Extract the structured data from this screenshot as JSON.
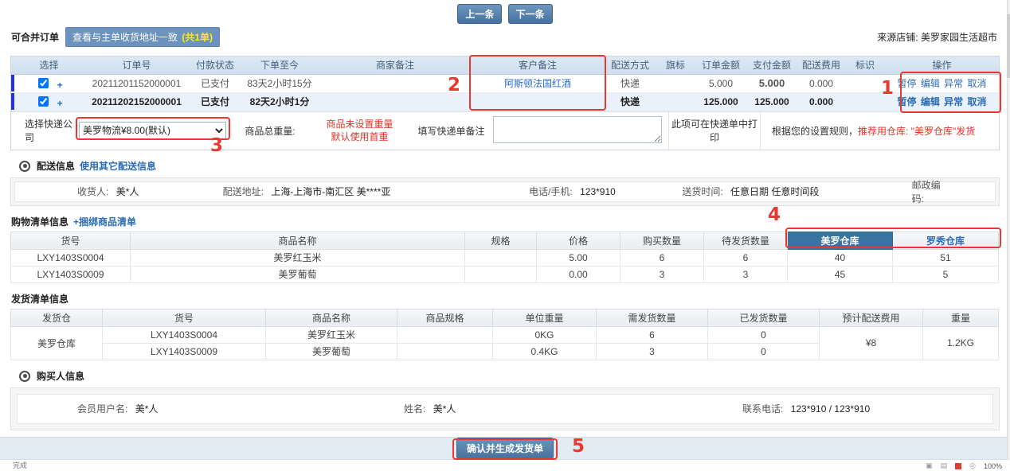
{
  "topbar": {
    "prev_button": "上一条",
    "next_button": "下一条"
  },
  "merge_bar": {
    "title": "可合并订单",
    "view_button": "查看与主单收货地址一致",
    "view_count": "(共1单)",
    "source_label": "来源店铺:",
    "source_value": "美罗家园生活超市"
  },
  "orders_table": {
    "headers": {
      "select": "选择",
      "order_no": "订单号",
      "pay_status": "付款状态",
      "since": "下单至今",
      "merchant_note": "商家备注",
      "customer_note": "客户备注",
      "delivery": "配送方式",
      "flag": "旗标",
      "order_amount": "订单金额",
      "pay_amount": "支付金额",
      "delivery_fee": "配送费用",
      "mark": "标识",
      "ops": "操作"
    },
    "op_labels": [
      "暂停",
      "编辑",
      "异常",
      "取消"
    ],
    "rows": [
      {
        "order_no": "20211201152000001",
        "pay_status": "已支付",
        "since": "83天2小时15分",
        "merchant_note": "",
        "customer_note": "阿斯顿法国红酒",
        "delivery": "快递",
        "flag": "",
        "order_amount": "5.000",
        "pay_amount": "5.000",
        "delivery_fee": "0.000",
        "mark": ""
      },
      {
        "order_no": "20211202152000001",
        "pay_status": "已支付",
        "since": "82天2小时1分",
        "merchant_note": "",
        "customer_note": "",
        "delivery": "快递",
        "flag": "",
        "order_amount": "125.000",
        "pay_amount": "125.000",
        "delivery_fee": "0.000",
        "mark": ""
      }
    ],
    "footer": {
      "express_label": "选择快递公司",
      "express_selected": "美罗物流¥8.00(默认)",
      "weight_label": "商品总重量:",
      "weight_warn_line1": "商品未设置重量",
      "weight_warn_line2": "默认使用首重",
      "note_label": "填写快递单备注",
      "print_hint": "此项可在快递单中打印",
      "rule_prefix": "根据您的设置规则，",
      "rule_red": "推荐用仓库: \"美罗仓库\"发货"
    }
  },
  "delivery_section": {
    "title": "配送信息",
    "other_link": "使用其它配送信息",
    "receiver_label": "收货人:",
    "receiver_value": "美*人",
    "address_label": "配送地址:",
    "address_value": "上海-上海市-南汇区 美****亚",
    "phone_label": "电话/手机:",
    "phone_value": "123*910",
    "time_label": "送货时间:",
    "time_value": "任意日期 任意时间段",
    "zip_label": "邮政编码:"
  },
  "purchase_section": {
    "title": "购物清单信息",
    "bundle_link": "+捆绑商品清单",
    "headers": {
      "sku": "货号",
      "name": "商品名称",
      "spec": "规格",
      "price": "价格",
      "qty": "购买数量",
      "pending": "待发货数量"
    },
    "warehouse_tabs": [
      {
        "label": "美罗仓库",
        "selected": true
      },
      {
        "label": "罗秀仓库",
        "selected": false
      }
    ],
    "rows": [
      {
        "sku": "LXY1403S0004",
        "name": "美罗红玉米",
        "spec": "",
        "price": "5.00",
        "qty": "6",
        "pending": "6",
        "wh1": "40",
        "wh2": "51"
      },
      {
        "sku": "LXY1403S0009",
        "name": "美罗葡萄",
        "spec": "",
        "price": "0.00",
        "qty": "3",
        "pending": "3",
        "wh1": "45",
        "wh2": "5"
      }
    ]
  },
  "shipment_section": {
    "title": "发货清单信息",
    "headers": {
      "warehouse": "发货仓",
      "sku": "货号",
      "name": "商品名称",
      "spec": "商品规格",
      "unit_weight": "单位重量",
      "need_qty": "需发货数量",
      "shipped_qty": "已发货数量",
      "est_fee": "预计配送费用",
      "weight": "重量"
    },
    "warehouse": "美罗仓库",
    "rows": [
      {
        "sku": "LXY1403S0004",
        "name": "美罗红玉米",
        "spec": "",
        "unit_weight": "0KG",
        "need_qty": "6",
        "shipped_qty": "0"
      },
      {
        "sku": "LXY1403S0009",
        "name": "美罗葡萄",
        "spec": "",
        "unit_weight": "0.4KG",
        "need_qty": "3",
        "shipped_qty": "0"
      }
    ],
    "est_fee": "¥8",
    "total_weight": "1.2KG"
  },
  "buyer_section": {
    "title": "购买人信息",
    "username_label": "会员用户名:",
    "username_value": "美*人",
    "name_label": "姓名:",
    "name_value": "美*人",
    "phone_label": "联系电话:",
    "phone_value": "123*910 / 123*910"
  },
  "footer_bar": {
    "confirm_button": "确认并生成发货单"
  },
  "statusbar": {
    "left_text": "完成",
    "zoom_text": "100%"
  },
  "annotations": {
    "n1": "1",
    "n2": "2",
    "n3": "3",
    "n4": "4",
    "n5": "5"
  },
  "colors": {
    "annotation_red": "#e8382f",
    "link_blue": "#2b6cb5",
    "price_red": "#ee0000",
    "selected_tab_bg": "#38759e",
    "primary_button_blue": "#46719e",
    "header_bg": "#d6e4f1"
  }
}
